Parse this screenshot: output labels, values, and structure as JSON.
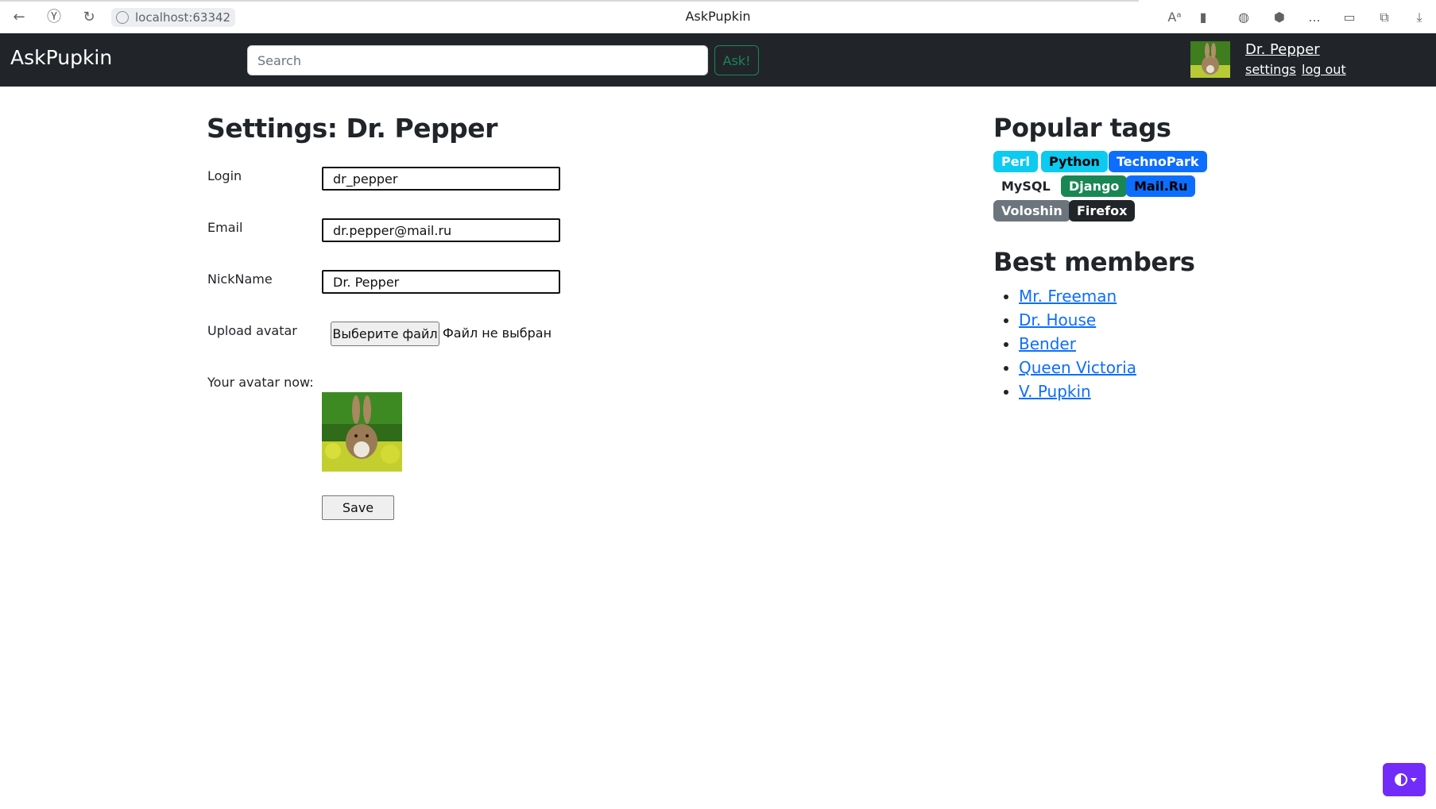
{
  "browser": {
    "url": "localhost:63342",
    "tab_title": "AskPupkin",
    "more": "..."
  },
  "navbar": {
    "brand": "AskPupkin",
    "search_placeholder": "Search",
    "ask_label": "Ask!",
    "user_name": "Dr. Pepper",
    "settings_label": "settings",
    "logout_label": "log out"
  },
  "settings": {
    "title": "Settings: Dr. Pepper",
    "login_label": "Login",
    "login_value": "dr_pepper",
    "email_label": "Email",
    "email_value": "dr.pepper@mail.ru",
    "nickname_label": "NickName",
    "nickname_value": "Dr. Pepper",
    "upload_label": "Upload avatar",
    "file_button_label": "Выберите файл",
    "file_status": "Файл не выбран",
    "avatar_label": "Your avatar now:",
    "save_label": "Save"
  },
  "sidebar": {
    "tags_title": "Popular tags",
    "tags": [
      {
        "label": "Perl",
        "color": "#0dcaf0",
        "text_color": "#ffffff"
      },
      {
        "label": "Python",
        "color": "#0dcaf0",
        "text_color": "#000000"
      },
      {
        "label": "TechnoPark",
        "color": "#0d6efd",
        "text_color": "#ffffff"
      },
      {
        "label": "MySQL",
        "color": "#ffffff",
        "text_color": "#212529"
      },
      {
        "label": "Django",
        "color": "#198754",
        "text_color": "#ffffff"
      },
      {
        "label": "Mail.Ru",
        "color": "#0d6efd",
        "text_color": "#000000"
      },
      {
        "label": "Voloshin",
        "color": "#6c757d",
        "text_color": "#ffffff"
      },
      {
        "label": "Firefox",
        "color": "#212529",
        "text_color": "#ffffff"
      }
    ],
    "members_title": "Best members",
    "members": [
      "Mr. Freeman",
      "Dr. House",
      "Bender",
      "Queen Victoria",
      "V. Pupkin"
    ]
  },
  "colors": {
    "navbar_bg": "#212529",
    "link": "#0d6efd",
    "success": "#198754",
    "theme_toggle": "#712cf9"
  }
}
